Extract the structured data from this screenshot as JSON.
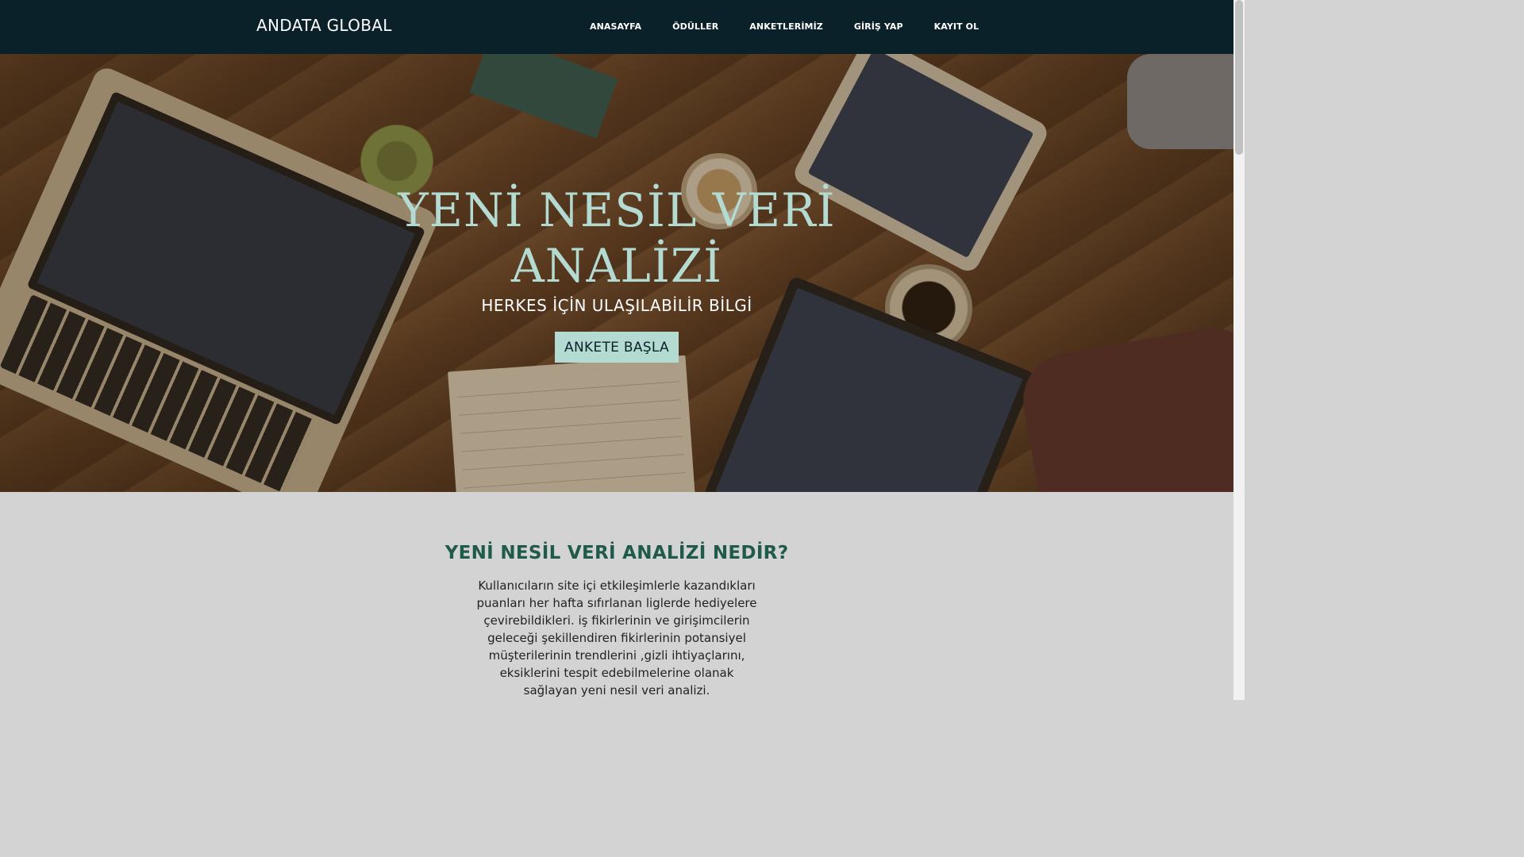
{
  "navbar": {
    "brand": "ANDATA GLOBAL",
    "links": [
      {
        "label": "ANASAYFA"
      },
      {
        "label": "ÖDÜLLER"
      },
      {
        "label": "ANKETLERİMİZ"
      },
      {
        "label": "GİRİŞ YAP"
      },
      {
        "label": "KAYIT OL"
      }
    ]
  },
  "hero": {
    "title_line1": "YENİ NESİL VERİ",
    "title_line2": "ANALİZİ",
    "subtitle": "HERKES İÇİN ULAŞILABİLİR BİLGİ",
    "button_label": "ANKETE BAŞLA",
    "image_subject": "workspace-photo-laptops-tablet-coffee-notebook"
  },
  "about": {
    "title": "YENİ NESİL VERİ ANALİZİ NEDİR?",
    "text": "Kullanıcıların site içi etkileşimlerle kazandıkları puanları her hafta sıfırlanan liglerde hediyelere çevirebildikleri. iş fikirlerinin ve girişimcilerin geleceği şekillendiren fikirlerinin potansiyel müşterilerinin trendlerini ,gizli ihtiyaçlarını, eksiklerini tespit edebilmelerine olanak sağlayan yeni nesil veri analizi."
  },
  "colors": {
    "navbar_bg": "#0b2129",
    "accent": "#b3dbd2",
    "heading_green": "#1f5a4a",
    "section_bg": "#d3d3d3"
  }
}
